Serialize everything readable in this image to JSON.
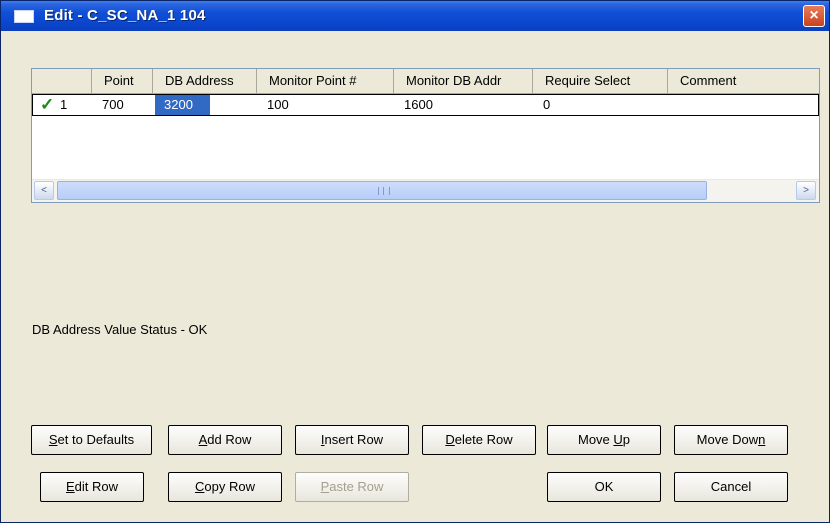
{
  "window": {
    "title": "Edit - C_SC_NA_1 104",
    "close_label": "×"
  },
  "grid": {
    "columns": [
      "Point",
      "DB Address",
      "Monitor Point #",
      "Monitor DB Addr",
      "Require Select",
      "Comment"
    ],
    "rows": [
      {
        "row_number": "1",
        "status_icon": "checkmark-icon",
        "point": "700",
        "db_address": "3200",
        "monitor_point": "100",
        "monitor_db_addr": "1600",
        "require_select": "0",
        "comment": ""
      }
    ],
    "selected_cell": "db_address",
    "scroll_left_glyph": "<",
    "scroll_right_glyph": ">"
  },
  "status": {
    "text": "DB Address Value Status - OK"
  },
  "buttons": {
    "set_defaults": {
      "pre": "",
      "key": "S",
      "post": "et to Defaults"
    },
    "add_row": {
      "pre": "",
      "key": "A",
      "post": "dd Row"
    },
    "insert_row": {
      "pre": "",
      "key": "I",
      "post": "nsert Row"
    },
    "delete_row": {
      "pre": "",
      "key": "D",
      "post": "elete Row"
    },
    "move_up": {
      "pre": "Move ",
      "key": "U",
      "post": "p"
    },
    "move_down": {
      "pre": "Move Dow",
      "key": "n",
      "post": ""
    },
    "edit_row": {
      "pre": "",
      "key": "E",
      "post": "dit Row"
    },
    "copy_row": {
      "pre": "",
      "key": "C",
      "post": "opy Row"
    },
    "paste_row": {
      "pre": "",
      "key": "P",
      "post": "aste Row"
    },
    "ok": {
      "pre": "OK",
      "key": "",
      "post": ""
    },
    "cancel": {
      "pre": "Cancel",
      "key": "",
      "post": ""
    }
  },
  "colors": {
    "title_bar": "#0a48cf",
    "selection": "#316ac5",
    "check": "#1a8a1a",
    "dialog_bg": "#ece9d8"
  }
}
